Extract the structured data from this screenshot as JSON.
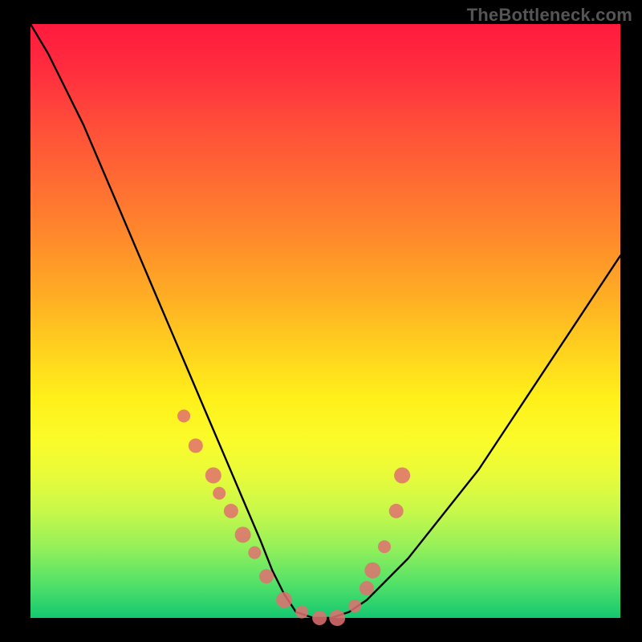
{
  "watermark": "TheBottleneck.com",
  "colors": {
    "curve_stroke": "#000000",
    "dot_fill": "#e07070",
    "background": "#000000"
  },
  "chart_data": {
    "type": "line",
    "title": "",
    "xlabel": "",
    "ylabel": "",
    "xlim": [
      0,
      100
    ],
    "ylim": [
      0,
      100
    ],
    "grid": false,
    "legend": false,
    "note": "Axes have no visible tick labels; values estimated from curve shape on a 0–100 normalized scale. Higher y = worse (red), 0 = best (green). Curve is a V-shaped bottleneck profile.",
    "series": [
      {
        "name": "bottleneck-curve",
        "x": [
          0,
          3,
          6,
          9,
          12,
          15,
          18,
          21,
          24,
          27,
          30,
          33,
          36,
          39,
          41,
          43,
          45,
          48,
          51,
          54,
          57,
          60,
          64,
          68,
          72,
          76,
          80,
          84,
          88,
          92,
          96,
          100
        ],
        "y": [
          100,
          95,
          89,
          83,
          76,
          69,
          62,
          55,
          48,
          41,
          34,
          27,
          20,
          13,
          8,
          4,
          1,
          0,
          0,
          1,
          3,
          6,
          10,
          15,
          20,
          25,
          31,
          37,
          43,
          49,
          55,
          61
        ]
      }
    ],
    "markers": {
      "name": "highlight-dots",
      "note": "Salmon dots clustered along the low part of the V. Values estimated.",
      "x": [
        26,
        28,
        31,
        32,
        34,
        36,
        38,
        40,
        43,
        46,
        49,
        52,
        55,
        57,
        58,
        60,
        62,
        63
      ],
      "y": [
        34,
        29,
        24,
        21,
        18,
        14,
        11,
        7,
        3,
        1,
        0,
        0,
        2,
        5,
        8,
        12,
        18,
        24
      ]
    }
  }
}
